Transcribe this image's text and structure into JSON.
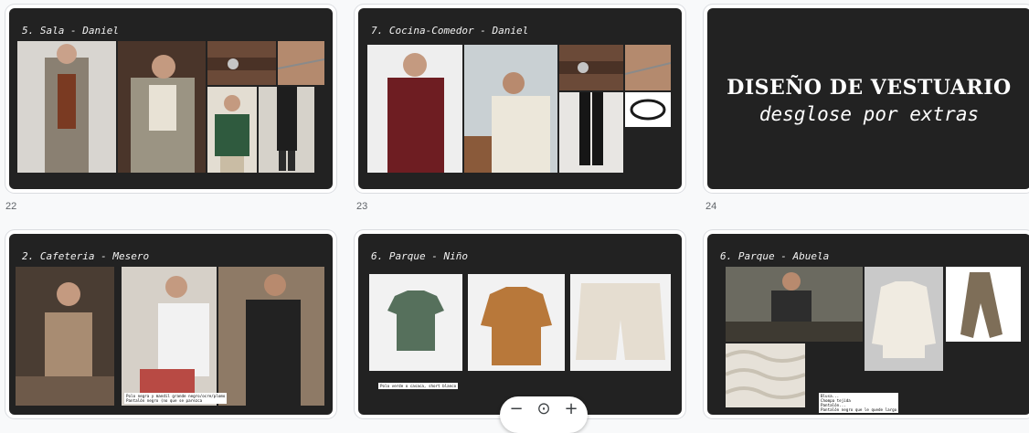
{
  "slides": [
    {
      "title": "5. Sala - Daniel"
    },
    {
      "title": "7. Cocina-Comedor - Daniel"
    },
    {
      "title_main": "DISEÑO DE VESTUARIO",
      "title_sub": "desglose por extras"
    },
    {
      "title": "2. Cafeteria - Mesero",
      "notes": [
        "Polo negra y mandil grande negro/ocre/plomo",
        "Pantalón negro (no que se parezca"
      ]
    },
    {
      "title": "6. Parque - Niño",
      "notes": [
        "Polo verde o casaca, short blanco"
      ]
    },
    {
      "title": "6. Parque - Abuela",
      "notes": [
        "Blusa...",
        "Chompa tejida",
        "Pantalón...",
        "Pantalón negro que le quede largo"
      ]
    }
  ],
  "page_numbers": [
    "22",
    "23",
    "24"
  ],
  "zoom": {
    "out": "−",
    "fit": "⊙",
    "in": "+"
  },
  "colors": {
    "slide_bg": "#222222",
    "page_bg": "#f8f9fa"
  }
}
